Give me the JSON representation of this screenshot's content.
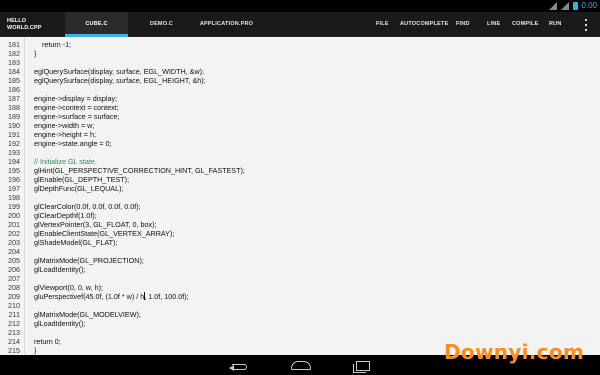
{
  "status": {
    "time": "0:00",
    "icons": [
      "wifi-icon",
      "signal-icon",
      "battery-icon"
    ],
    "accent": "#33b5e5"
  },
  "app": {
    "title_line1": "HELLO",
    "title_line2": "WORLD.CPP"
  },
  "tabs": [
    {
      "label": "CUBE.C",
      "active": true
    },
    {
      "label": "DEMO.C",
      "active": false
    },
    {
      "label": "APPLICATION.PRO",
      "active": false
    }
  ],
  "actions": [
    "FILE",
    "AUTOCOMPLETE",
    "FIND",
    "LINE",
    "COMPILE",
    "RUN"
  ],
  "editor": {
    "lines": [
      {
        "n": "181",
        "text": "    return -1;"
      },
      {
        "n": "182",
        "text": "}"
      },
      {
        "n": "183",
        "text": ""
      },
      {
        "n": "184",
        "text": "eglQuerySurface(display, surface, EGL_WIDTH, &w);"
      },
      {
        "n": "185",
        "text": "eglQuerySurface(display, surface, EGL_HEIGHT, &h);"
      },
      {
        "n": "186",
        "text": ""
      },
      {
        "n": "187",
        "text": "engine->display = display;"
      },
      {
        "n": "188",
        "text": "engine->context = context;"
      },
      {
        "n": "189",
        "text": "engine->surface = surface;"
      },
      {
        "n": "190",
        "text": "engine->width = w;"
      },
      {
        "n": "191",
        "text": "engine->height = h;"
      },
      {
        "n": "192",
        "text": "engine->state.angle = 0;"
      },
      {
        "n": "193",
        "text": ""
      },
      {
        "n": "194",
        "text": "// Initialize GL state.",
        "comment": true
      },
      {
        "n": "195",
        "text": "glHint(GL_PERSPECTIVE_CORRECTION_HINT, GL_FASTEST);"
      },
      {
        "n": "196",
        "text": "glEnable(GL_DEPTH_TEST);"
      },
      {
        "n": "197",
        "text": "glDepthFunc(GL_LEQUAL);"
      },
      {
        "n": "198",
        "text": ""
      },
      {
        "n": "199",
        "text": "glClearColor(0.0f, 0.0f, 0.0f, 0.0f);"
      },
      {
        "n": "200",
        "text": "glClearDepthf(1.0f);"
      },
      {
        "n": "201",
        "text": "glVertexPointer(3, GL_FLOAT, 0, box);"
      },
      {
        "n": "202",
        "text": "glEnableClientState(GL_VERTEX_ARRAY);"
      },
      {
        "n": "203",
        "text": "glShadeModel(GL_FLAT);"
      },
      {
        "n": "204",
        "text": ""
      },
      {
        "n": "205",
        "text": "glMatrixMode(GL_PROJECTION);"
      },
      {
        "n": "206",
        "text": "glLoadIdentity();"
      },
      {
        "n": "207",
        "text": ""
      },
      {
        "n": "208",
        "text": "glViewport(0, 0, w, h);"
      },
      {
        "n": "209",
        "text": "gluPerspectivef(45.0f, (1.0f * w) / h, 1.0f, 100.0f);"
      },
      {
        "n": "210",
        "text": ""
      },
      {
        "n": "211",
        "text": "glMatrixMode(GL_MODELVIEW);"
      },
      {
        "n": "212",
        "text": "glLoadIdentity();"
      },
      {
        "n": "213",
        "text": ""
      },
      {
        "n": "214",
        "text": "return 0;"
      },
      {
        "n": "215",
        "text": "}"
      }
    ],
    "comment_color": "#2e8b57"
  },
  "navigation": {
    "icons": [
      "back-icon",
      "home-icon",
      "recents-icon"
    ]
  },
  "watermark": {
    "text": "Downyi.com",
    "color": "#ff8c1a"
  }
}
